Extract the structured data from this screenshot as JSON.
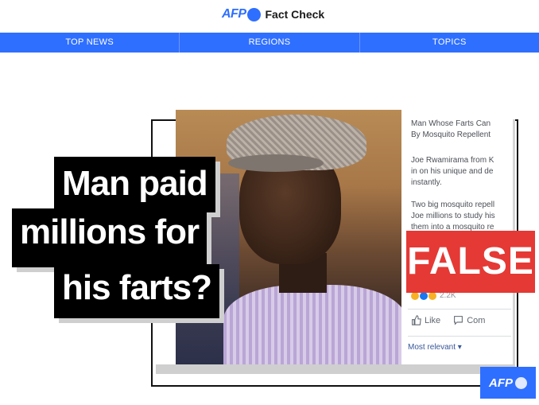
{
  "header": {
    "brand_afp": "AFP",
    "title": "Fact Check",
    "accent_color": "#2f6fff"
  },
  "nav": {
    "items": [
      "TOP NEWS",
      "REGIONS",
      "TOPICS"
    ]
  },
  "post": {
    "lines": [
      "Man Whose Farts Can",
      "By Mosquito Repellent",
      "Joe Rwamirama from K",
      "in on his unique and de",
      "instantly.",
      "Two big mosquito repell",
      "Joe millions to study his",
      "them into a mosquito re"
    ],
    "reaction_count": "2.2K",
    "like_label": "Like",
    "comment_label": "Com",
    "most_relevant": "Most relevant ▾"
  },
  "headline": {
    "line1": "Man paid",
    "line2": "millions for",
    "line3": "his farts?"
  },
  "verdict": {
    "label": "FALSE",
    "color": "#e53935"
  },
  "corner_logo": {
    "label": "AFP"
  }
}
